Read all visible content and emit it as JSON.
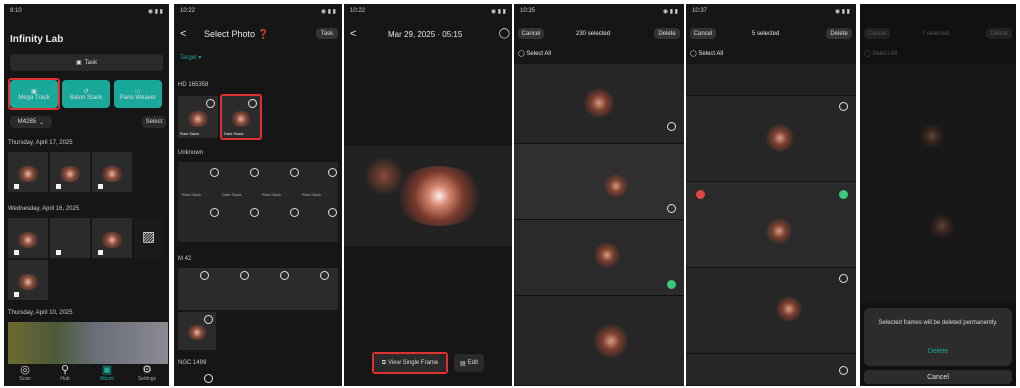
{
  "colors": {
    "accent_teal": "#1aa89a",
    "highlight_red": "#e03030",
    "bg": "#161616",
    "green_check": "#3cc87a",
    "red_dot": "#e04848"
  },
  "p1": {
    "time": "8:10",
    "title": "Infinity Lab",
    "task_label": "Task",
    "modes": [
      "Mega Track",
      "Baton Stack",
      "Pano Weaver"
    ],
    "filter": "M4285",
    "select_label": "Select",
    "dates": [
      "Thursday, April 17, 2025",
      "Wednesday, April 16, 2025",
      "Thursday, April 10, 2025"
    ],
    "tabs": [
      "Scan",
      "Hub",
      "Album",
      "Settings"
    ]
  },
  "p2": {
    "time": "10:22",
    "back": "<",
    "title": "Select Photo",
    "task_label": "Task",
    "target_label": "Target",
    "groups": [
      "HD 165358",
      "Unknown",
      "M 42",
      "NGC 1499"
    ],
    "cell_labels": [
      "Raw Stack",
      "Dark Stack",
      "Raw Stack",
      "Dark Stack",
      "Raw Stack",
      "Raw Stack"
    ]
  },
  "p3": {
    "time": "10:22",
    "back": "<",
    "title": "Mar 29, 2025 · 05:15",
    "view_single": "View Single Frame",
    "edit": "Edit"
  },
  "p4": {
    "time": "10:35",
    "cancel": "Cancel",
    "count": "230 selected",
    "delete": "Delete",
    "select_all": "Select All"
  },
  "p5": {
    "time": "10:37",
    "cancel": "Cancel",
    "count": "5 selected",
    "delete": "Delete",
    "select_all": "Select All"
  },
  "p6": {
    "cancel": "Cancel",
    "count": "7 selected",
    "delete": "Delete",
    "select_all": "Select All",
    "dialog_text": "Selected frames will be deleted permanently.",
    "dialog_delete": "Delete",
    "dialog_cancel": "Cancel"
  }
}
